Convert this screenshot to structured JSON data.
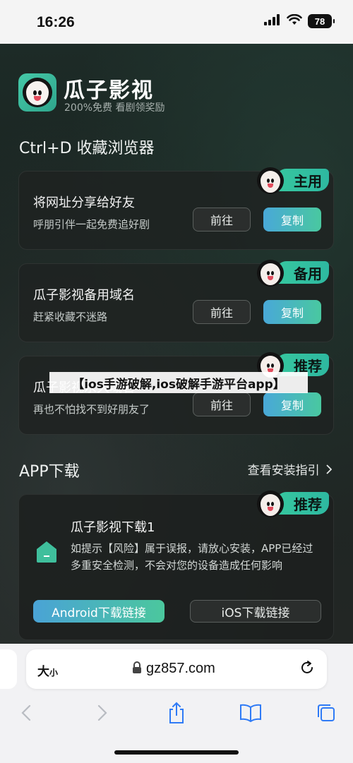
{
  "status": {
    "time": "16:26",
    "battery": "78"
  },
  "site": {
    "app_name": "瓜子影视",
    "app_tagline": "200%免费 看剧领奖励",
    "bookmark_heading": "Ctrl+D 收藏浏览器"
  },
  "cards": [
    {
      "badge": "主用",
      "title": "将网址分享给好友",
      "subtitle": "呼朋引伴一起免费追好剧",
      "go_label": "前往",
      "copy_label": "复制"
    },
    {
      "badge": "备用",
      "title": "瓜子影视备用域名",
      "subtitle": "赶紧收藏不迷路",
      "go_label": "前往",
      "copy_label": "复制"
    },
    {
      "badge": "推荐",
      "title": "瓜子影视永久域名",
      "subtitle": "再也不怕找不到好朋友了",
      "go_label": "前往",
      "copy_label": "复制"
    }
  ],
  "overlay_banner": "【ios手游破解,ios破解手游平台app】",
  "app_section": {
    "title": "APP下载",
    "guide_link": "查看安装指引",
    "card": {
      "badge": "推荐",
      "title": "瓜子影视下载1",
      "description": "如提示【风险】属于误报，请放心安装，APP已经过多重安全检测，不会对您的设备造成任何影响",
      "android_label": "Android下载链接",
      "ios_label": "iOS下载链接"
    }
  },
  "browser": {
    "text_size_label": "大",
    "text_size_small": "小",
    "url": "gz857.com"
  }
}
